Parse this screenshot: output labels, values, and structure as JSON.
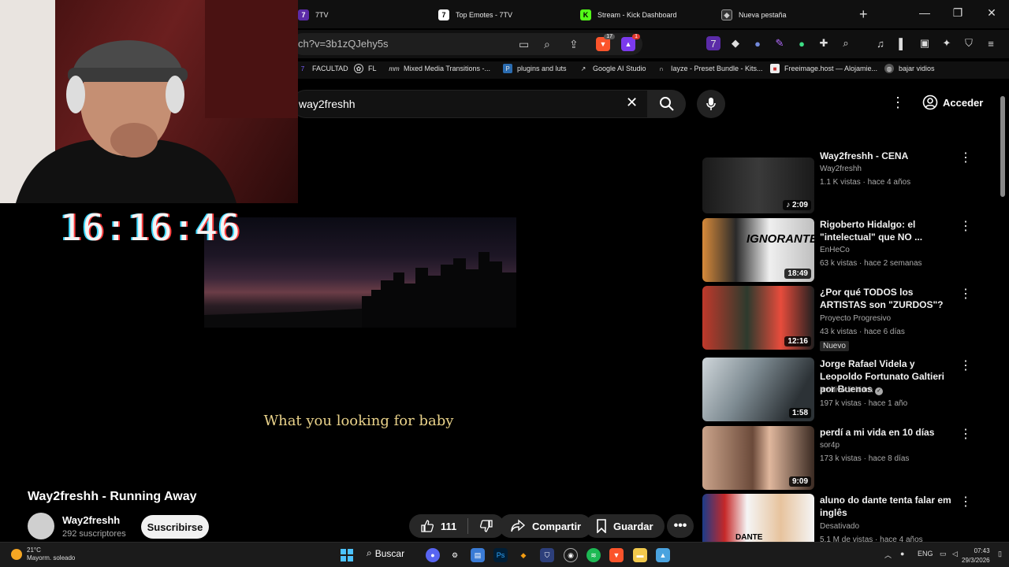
{
  "tabs": [
    {
      "label": "7TV",
      "icon": "7tv-icon"
    },
    {
      "label": "Top Emotes - 7TV",
      "icon": "7tv-icon"
    },
    {
      "label": "Stream - Kick Dashboard",
      "icon": "kick-icon"
    },
    {
      "label": "Nueva pestaña",
      "icon": "brave-icon"
    }
  ],
  "address": {
    "url": "ch?v=3b1zQJehy5s"
  },
  "brave": {
    "shields_count": "17",
    "rewards_count": "1"
  },
  "bookmarks": [
    {
      "label": "FACULTAD"
    },
    {
      "label": "FL"
    },
    {
      "label": "Mixed Media Transitions -..."
    },
    {
      "label": "plugins and luts"
    },
    {
      "label": "Google AI Studio"
    },
    {
      "label": "Iayze - Preset Bundle - Kits..."
    },
    {
      "label": "Freeimage.host — Alojamie..."
    },
    {
      "label": "bajar vidios"
    }
  ],
  "youtube": {
    "search_query": "way2freshh",
    "signin_label": "Acceder",
    "video_title": "Way2freshh - Running Away",
    "subtitle": "What you looking for baby",
    "channel_name": "Way2freshh",
    "subscribers": "292 suscriptores",
    "subscribe_label": "Suscribirse",
    "likes": "111",
    "share_label": "Compartir",
    "save_label": "Guardar"
  },
  "overlay": {
    "clock": "16:16:46"
  },
  "related": [
    {
      "title": "Way2freshh - CENA",
      "channel": "Way2freshh",
      "meta": "1.1 K vistas · hace 4 años",
      "duration": "♪ 2:09",
      "badge": ""
    },
    {
      "title": "Rigoberto Hidalgo: el \"intelectual\" que NO ...",
      "channel": "EnHeCo",
      "meta": "63 k vistas · hace 2 semanas",
      "duration": "18:49",
      "badge": ""
    },
    {
      "title": "¿Por qué TODOS los ARTISTAS son \"ZURDOS\"?",
      "channel": "Proyecto Progresivo",
      "meta": "43 k vistas · hace 6 días",
      "duration": "12:16",
      "badge": "Nuevo"
    },
    {
      "title": "Jorge Rafael Videla y Leopoldo Fortunato Galtieri por Buenos ...",
      "channel": "archivodichiara",
      "meta": "197 k vistas · hace 1 año",
      "duration": "1:58",
      "badge": ""
    },
    {
      "title": "perdí a mi vida en 10 días",
      "channel": "sor4p",
      "meta": "173 k vistas · hace 8 días",
      "duration": "9:09",
      "badge": ""
    },
    {
      "title": "aluno do dante tenta falar em inglês",
      "channel": "Desativado",
      "meta": "5.1 M de vistas · hace 4 años",
      "duration": "",
      "badge": ""
    }
  ],
  "thumb_text": {
    "ignorante": "IGNORANTE",
    "dante": "DANTE"
  },
  "taskbar": {
    "weather_temp": "21°C",
    "weather_desc": "Mayorm. soleado",
    "search_label": "Buscar",
    "lang": "ENG",
    "time": "07:43",
    "date": "29/3/2026"
  }
}
